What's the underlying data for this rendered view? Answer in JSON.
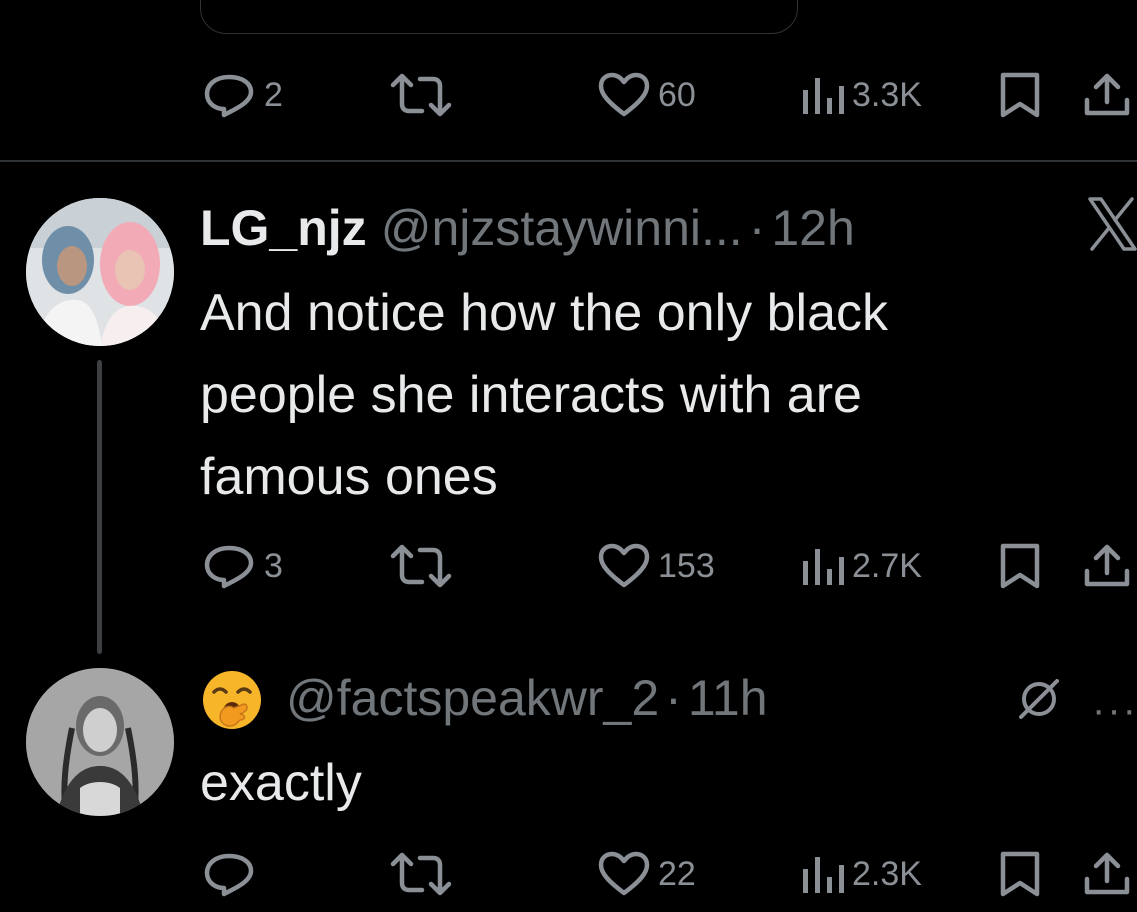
{
  "top_post": {
    "actions": {
      "reply_count": "2",
      "repost_count": "",
      "like_count": "60",
      "view_count": "3.3K"
    }
  },
  "reply1": {
    "display_name": "LG_njz",
    "handle": "@njzstaywinni...",
    "separator": "·",
    "time": "12h",
    "text_line1": "And notice how the only black",
    "text_line2": "people she interacts with are",
    "text_line3": "famous ones",
    "actions": {
      "reply_count": "3",
      "like_count": "153",
      "view_count": "2.7K"
    },
    "badge_icon": "x-logo-icon"
  },
  "reply2": {
    "display_name_emoji": "🥱",
    "handle": "@factspeakwr_2",
    "separator": "·",
    "time": "11h",
    "text": "exactly",
    "actions": {
      "reply_count": "",
      "like_count": "22",
      "view_count": "2.3K"
    },
    "status_icon": "muted-circle-slash-icon",
    "more_label": "···"
  },
  "colors": {
    "background": "#000000",
    "text_primary": "#e7e9ea",
    "text_secondary": "#71767b",
    "border": "#2f3336"
  }
}
